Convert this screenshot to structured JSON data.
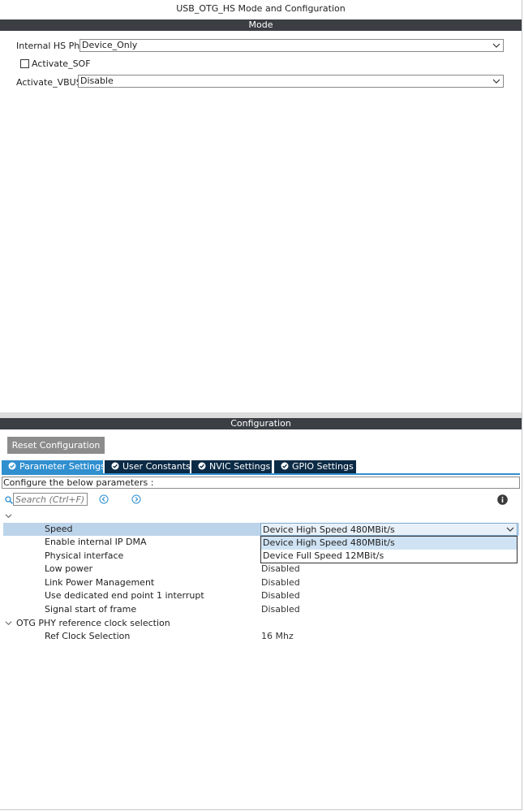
{
  "title": "USB_OTG_HS Mode and Configuration",
  "mode_section": {
    "header": "Mode",
    "internal_hs_phy": {
      "label": "Internal HS Phy",
      "value": "Device_Only"
    },
    "activate_sof": {
      "label": "Activate_SOF",
      "checked": false
    },
    "activate_vbus": {
      "label": "Activate_VBUS",
      "value": "Disable"
    }
  },
  "config_section": {
    "header": "Configuration",
    "reset_button": "Reset Configuration",
    "tabs": [
      {
        "label": "Parameter Settings",
        "active": true,
        "icon": "check-circle-icon"
      },
      {
        "label": "User Constants",
        "active": false,
        "icon": "check-circle-icon"
      },
      {
        "label": "NVIC Settings",
        "active": false,
        "icon": "check-circle-icon"
      },
      {
        "label": "GPIO Settings",
        "active": false,
        "icon": "check-circle-icon"
      }
    ],
    "instruction": "Configure the below parameters :",
    "search": {
      "placeholder": "Search (Ctrl+F)"
    },
    "params": [
      {
        "label": "Speed",
        "value": "Device High Speed 480MBit/s",
        "selected": true
      },
      {
        "label": "Enable internal IP DMA",
        "value": ""
      },
      {
        "label": "Physical interface",
        "value": ""
      },
      {
        "label": "Low power",
        "value": "Disabled"
      },
      {
        "label": "Link Power Management",
        "value": "Disabled"
      },
      {
        "label": "Use dedicated end point 1 interrupt",
        "value": "Disabled"
      },
      {
        "label": "Signal start of frame",
        "value": "Disabled"
      }
    ],
    "group2": {
      "label": "OTG PHY reference clock selection",
      "params": [
        {
          "label": "Ref Clock Selection",
          "value": "16 Mhz"
        }
      ]
    },
    "speed_dropdown": {
      "options": [
        "Device High Speed 480MBit/s",
        "Device Full Speed 12MBit/s"
      ],
      "highlighted": 0
    }
  },
  "colors": {
    "header_bar": "#3b3f44",
    "tab_active": "#2f8fcf",
    "tab_inactive": "#0b2a45",
    "row_selected": "#bcd4ea"
  }
}
